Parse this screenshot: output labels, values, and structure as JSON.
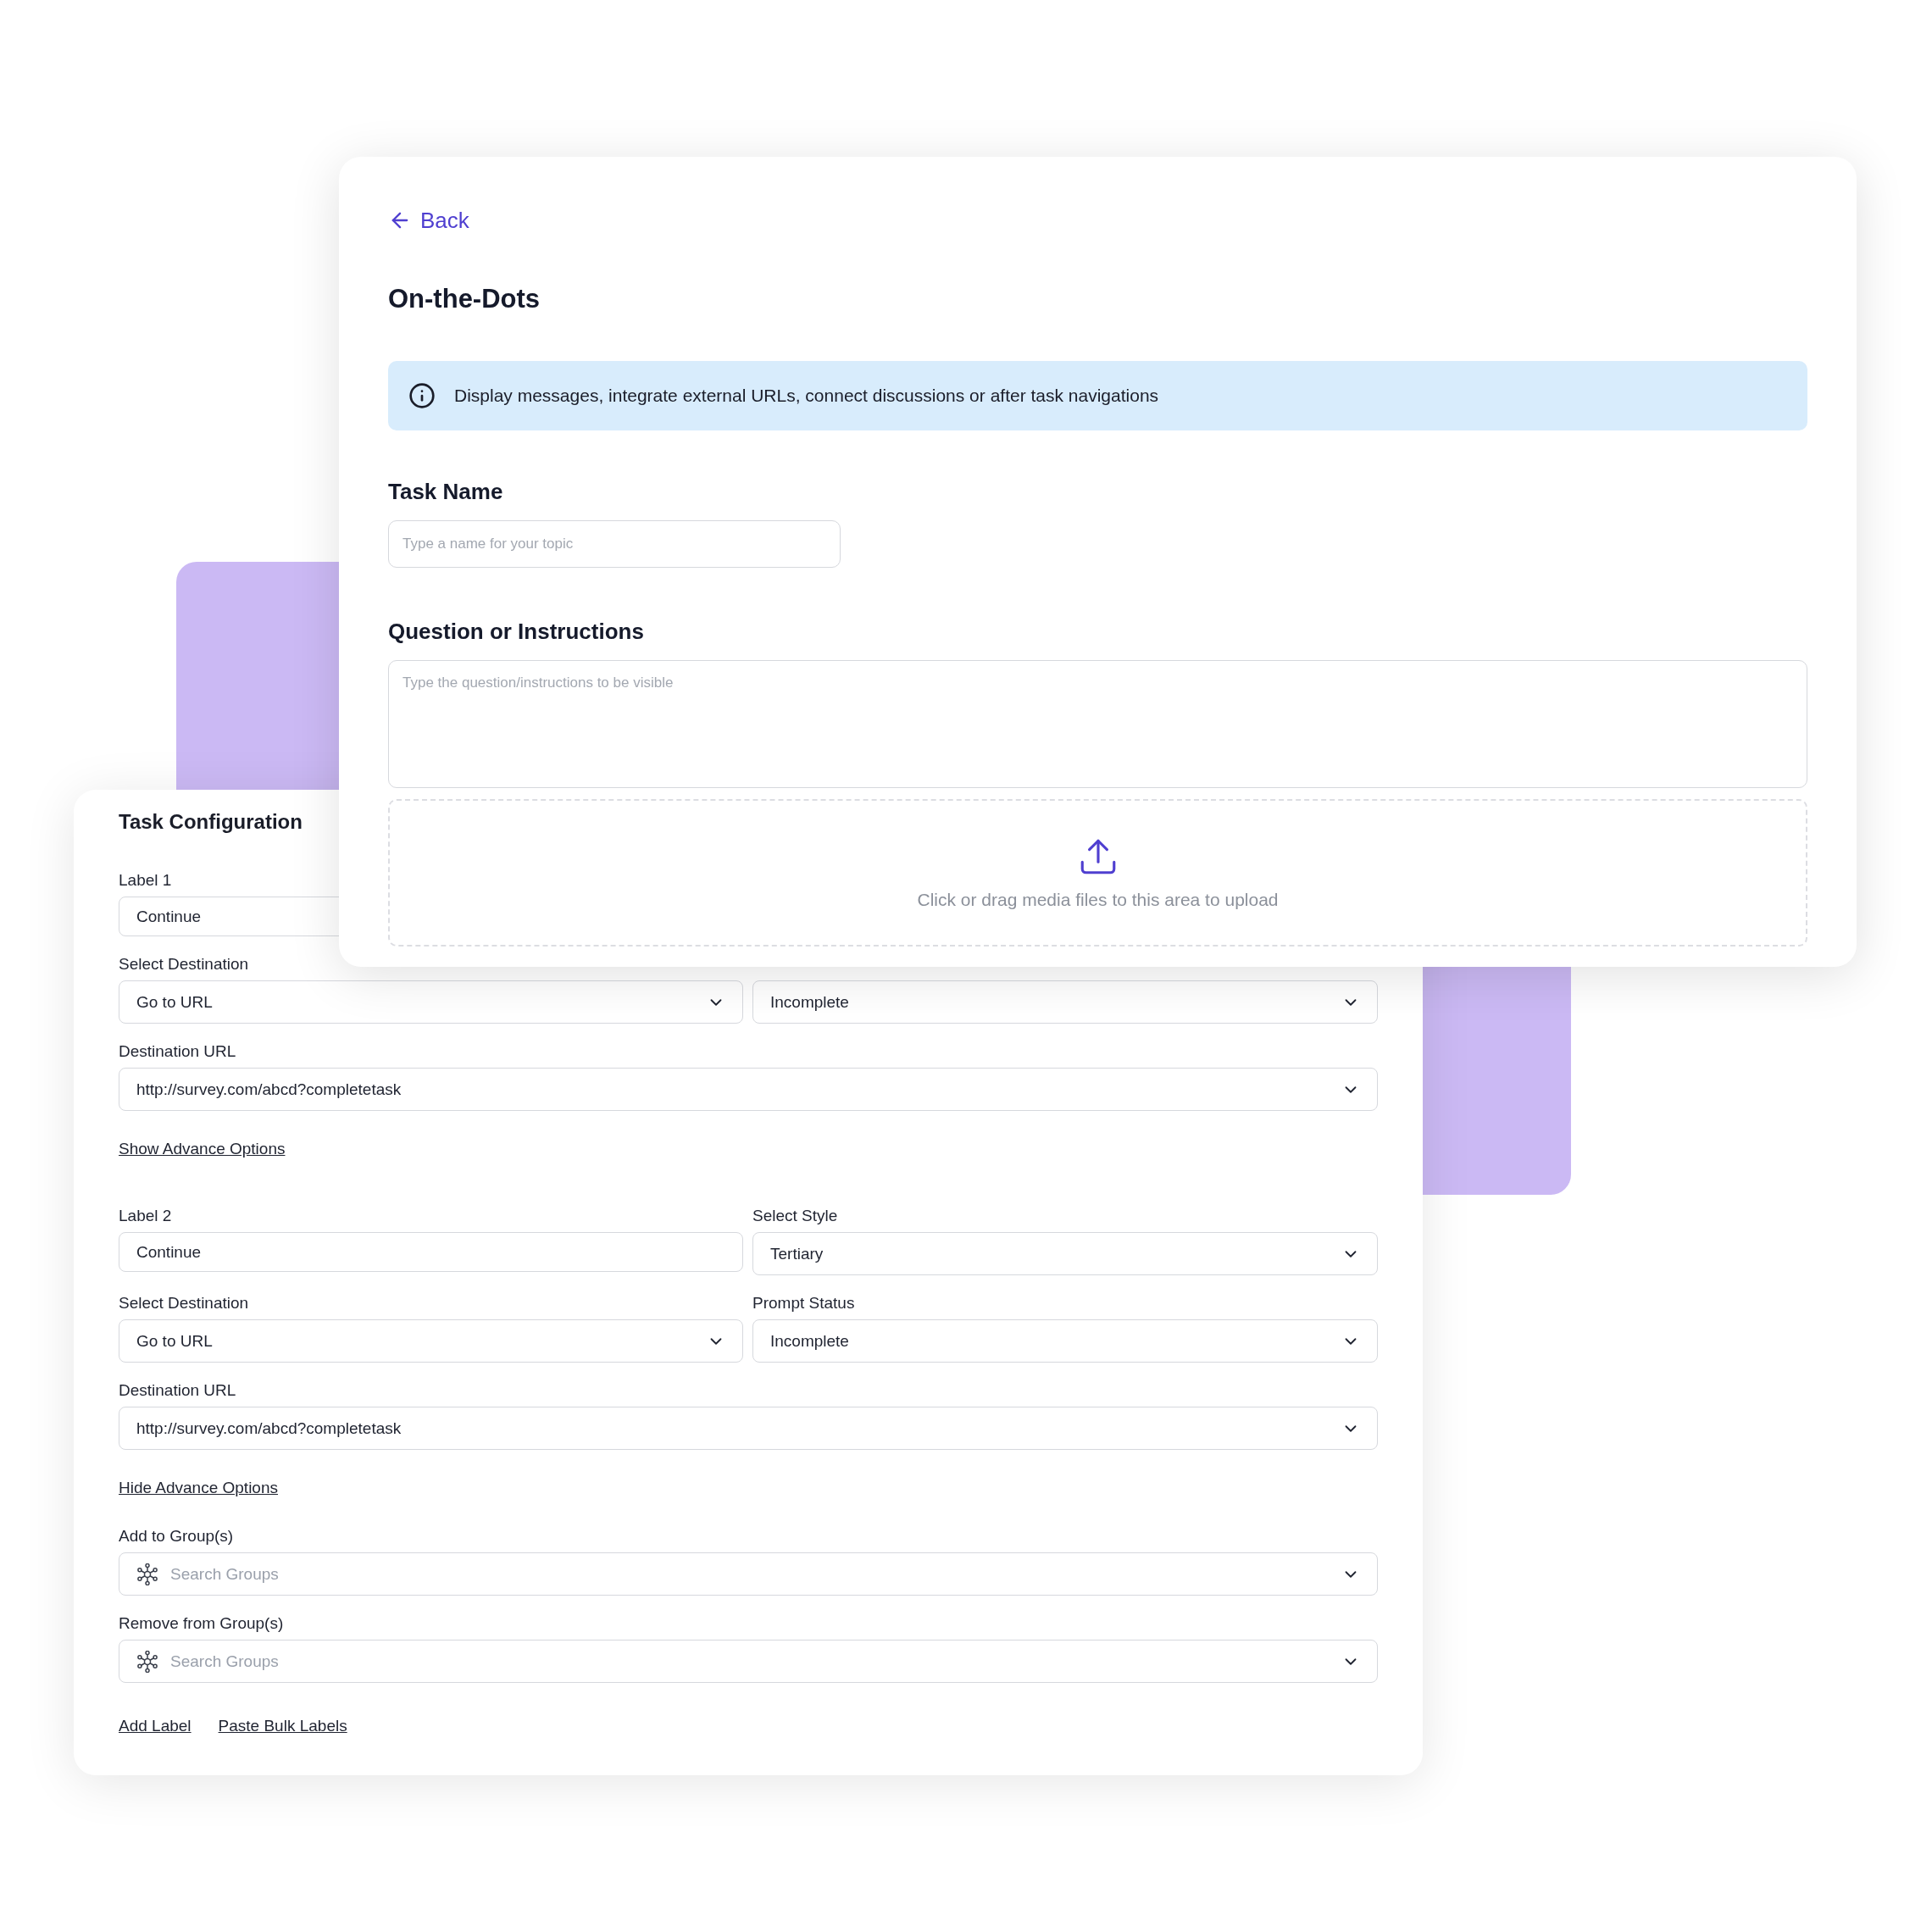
{
  "config_card": {
    "title": "Task Configuration",
    "items": [
      {
        "kind": "row",
        "fields": [
          {
            "kind": "input",
            "label": "Label 1",
            "value": "Continue"
          }
        ]
      },
      {
        "kind": "row",
        "fields": [
          {
            "kind": "select",
            "label": "Select Destination",
            "value": "Go to URL"
          },
          {
            "kind": "select",
            "value": "Incomplete"
          }
        ]
      },
      {
        "kind": "row",
        "fields": [
          {
            "kind": "wide-select",
            "label": "Destination URL",
            "value": "http://survey.com/abcd?completetask"
          }
        ]
      },
      {
        "kind": "link",
        "text": "Show Advance Options"
      },
      {
        "kind": "row",
        "fields": [
          {
            "kind": "input",
            "label": "Label 2",
            "value": "Continue"
          },
          {
            "kind": "select",
            "label": "Select Style",
            "value": "Tertiary"
          }
        ]
      },
      {
        "kind": "row",
        "fields": [
          {
            "kind": "select",
            "label": "Select Destination",
            "value": "Go to URL"
          },
          {
            "kind": "select",
            "label": "Prompt Status",
            "value": "Incomplete"
          }
        ]
      },
      {
        "kind": "row",
        "fields": [
          {
            "kind": "wide-select",
            "label": "Destination URL",
            "value": "http://survey.com/abcd?completetask"
          }
        ]
      },
      {
        "kind": "link",
        "text": "Hide Advance Options"
      },
      {
        "kind": "row",
        "fields": [
          {
            "kind": "group-search",
            "label": "Add to Group(s)",
            "placeholder": "Search Groups"
          }
        ]
      },
      {
        "kind": "row",
        "fields": [
          {
            "kind": "group-search",
            "label": "Remove from Group(s)",
            "placeholder": "Search Groups"
          }
        ]
      },
      {
        "kind": "links",
        "links": [
          "Add Label",
          "Paste Bulk Labels"
        ]
      }
    ]
  },
  "main_card": {
    "back_link": "Back",
    "title": "On-the-Dots",
    "info_banner": "Display messages, integrate external URLs, connect discussions or after task navigations",
    "task_name": {
      "label": "Task Name",
      "placeholder": "Type a name for your topic"
    },
    "question": {
      "label": "Question or Instructions",
      "placeholder": "Type the question/instructions to be visible"
    },
    "upload": {
      "text": "Click or drag media files to this area to upload"
    }
  }
}
